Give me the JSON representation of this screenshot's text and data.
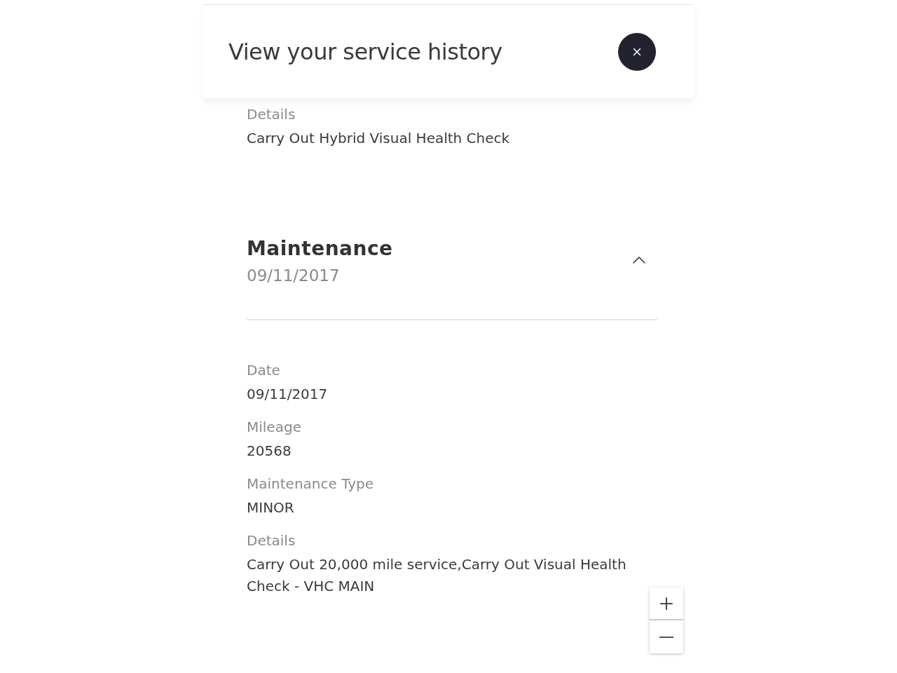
{
  "header": {
    "title": "View your service history"
  },
  "previous_fields": [
    {
      "label": "Details",
      "value": "Carry Out Hybrid Visual Health Check"
    }
  ],
  "section": {
    "title": "Maintenance",
    "date": "09/11/2017",
    "expanded": true,
    "fields": [
      {
        "label": "Date",
        "value": "09/11/2017"
      },
      {
        "label": "Mileage",
        "value": "20568"
      },
      {
        "label": "Maintenance Type",
        "value": "MINOR"
      },
      {
        "label": "Details",
        "value": "Carry Out 20,000 mile service,Carry Out Visual Health Check - VHC MAIN"
      }
    ]
  }
}
